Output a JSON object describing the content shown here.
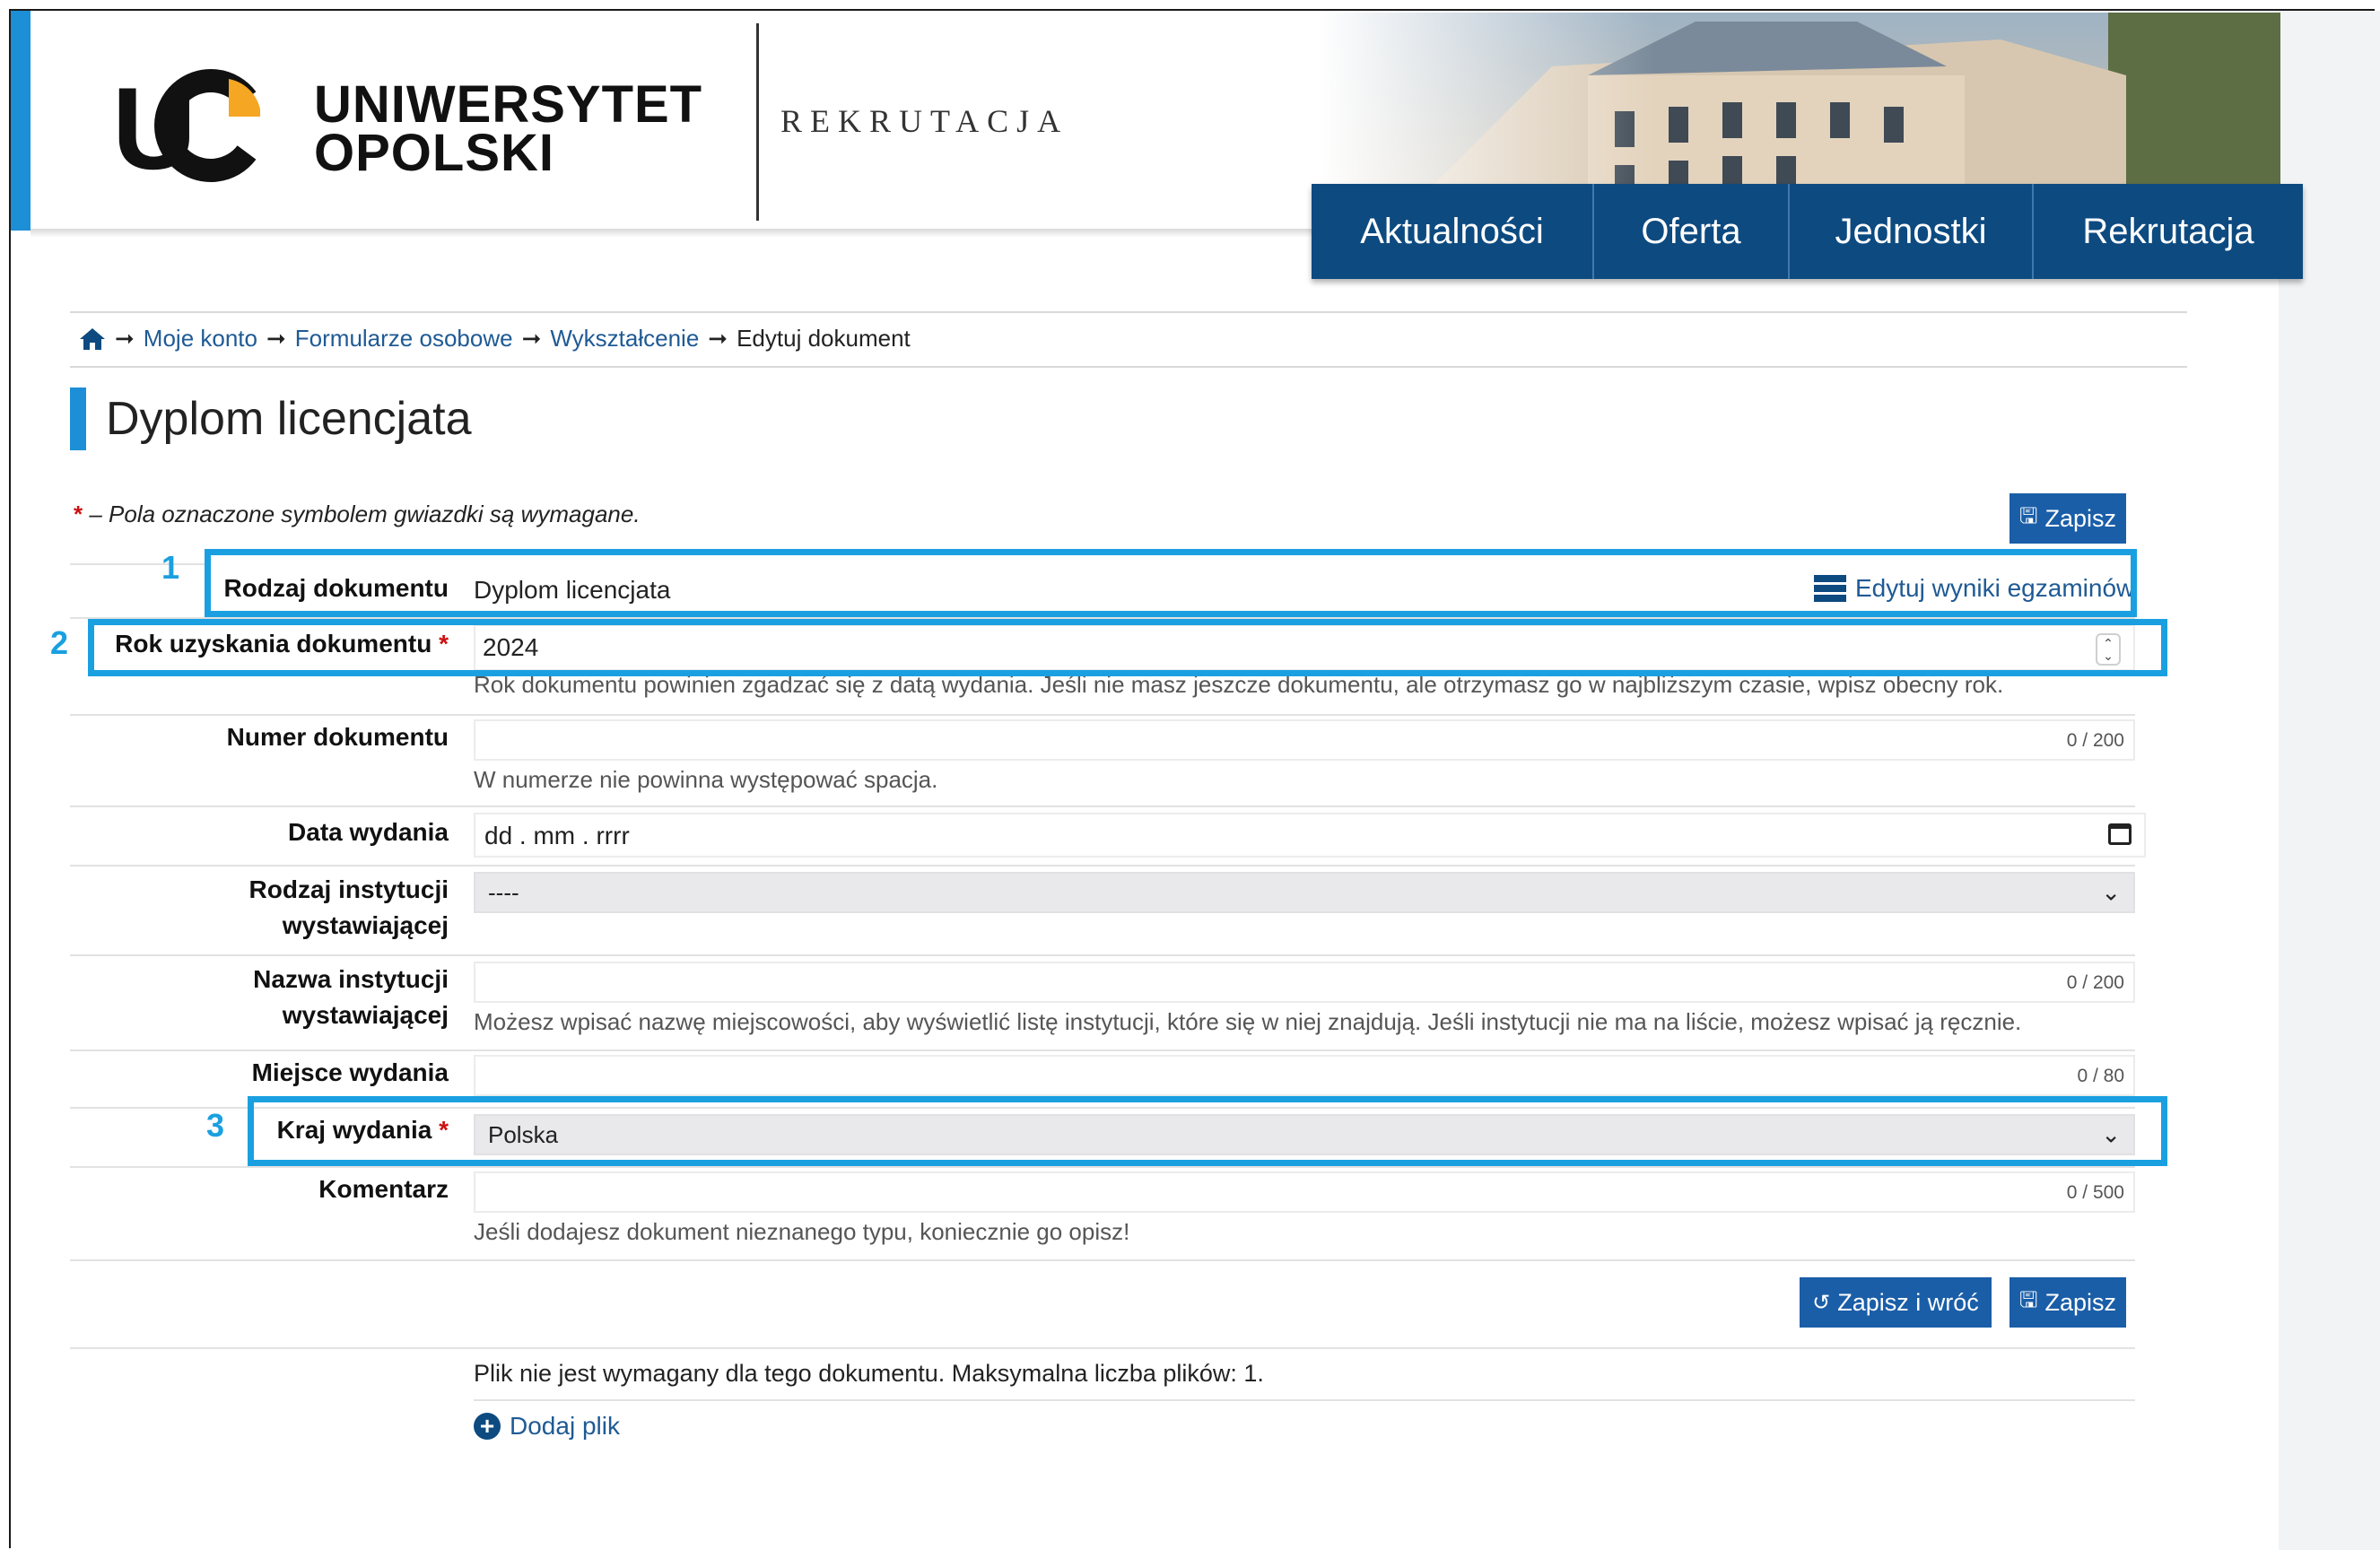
{
  "header": {
    "logo_mark": "UO",
    "logo_line1": "UNIWERSYTET",
    "logo_line2": "OPOLSKI",
    "section_label": "REKRUTACJA"
  },
  "nav": {
    "items": [
      {
        "label": "Aktualności"
      },
      {
        "label": "Oferta"
      },
      {
        "label": "Jednostki"
      },
      {
        "label": "Rekrutacja"
      }
    ]
  },
  "breadcrumb": {
    "home_icon": "home-icon",
    "items": [
      "Moje konto",
      "Formularze osobowe",
      "Wykształcenie",
      "Edytuj dokument"
    ]
  },
  "page": {
    "title": "Dyplom licencjata",
    "required_note_star": "*",
    "required_note": "– Pola oznaczone symbolem gwiazdki są wymagane."
  },
  "buttons": {
    "save_top": "Zapisz",
    "save_and_back": "Zapisz i wróć",
    "save_bottom": "Zapisz"
  },
  "form": {
    "doc_type": {
      "label": "Rodzaj dokumentu",
      "value": "Dyplom licencjata",
      "edit_link": "Edytuj wyniki egzaminów"
    },
    "year": {
      "label": "Rok uzyskania dokumentu",
      "star": "*",
      "value": "2024",
      "help": "Rok dokumentu powinien zgadzać się z datą wydania. Jeśli nie masz jeszcze dokumentu, ale otrzymasz go w najbliższym czasie, wpisz obecny rok."
    },
    "number": {
      "label": "Numer dokumentu",
      "value": "",
      "counter": "0 / 200",
      "help": "W numerze nie powinna występować spacja."
    },
    "issue_date": {
      "label": "Data wydania",
      "placeholder": "dd . mm . rrrr"
    },
    "institution_type": {
      "label_line1": "Rodzaj instytucji",
      "label_line2": "wystawiającej",
      "value": "----"
    },
    "institution_name": {
      "label_line1": "Nazwa instytucji",
      "label_line2": "wystawiającej",
      "value": "",
      "counter": "0 / 200",
      "help": "Możesz wpisać nazwę miejscowości, aby wyświetlić listę instytucji, które się w niej znajdują. Jeśli instytucji nie ma na liście, możesz wpisać ją ręcznie."
    },
    "issue_place": {
      "label": "Miejsce wydania",
      "value": "",
      "counter": "0 / 80"
    },
    "country": {
      "label": "Kraj wydania",
      "star": "*",
      "value": "Polska"
    },
    "comment": {
      "label": "Komentarz",
      "value": "",
      "counter": "0 / 500",
      "help": "Jeśli dodajesz dokument nieznanego typu, koniecznie go opisz!"
    }
  },
  "files": {
    "note": "Plik nie jest wymagany dla tego dokumentu. Maksymalna liczba plików: 1.",
    "add_file": "Dodaj plik"
  },
  "annotations": {
    "n1": "1",
    "n2": "2",
    "n3": "3",
    "color": "#1aa0e0"
  },
  "colors": {
    "accent_blue": "#1c8fd6",
    "nav_bg": "#0d4a80",
    "button_bg": "#1a5ea8",
    "link": "#1f5a94",
    "required": "#cc1111"
  }
}
